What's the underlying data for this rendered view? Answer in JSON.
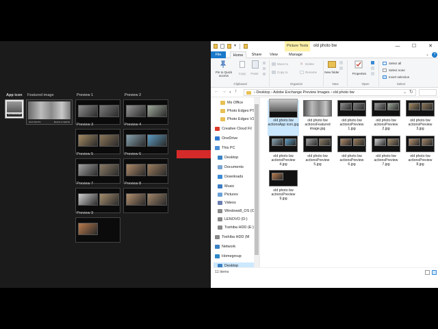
{
  "left_panel": {
    "app_icon_label": "App icon",
    "featured_label": "Featured image",
    "app_icon_caption": "OLD PHOTO BW",
    "featured_caption_left": "OLD PHOTO",
    "featured_caption_right": "BLACK & WHITE",
    "previews": [
      {
        "label": "Preview 1",
        "mini_a": "#8c8c8c",
        "mini_b": "#7a7a7a"
      },
      {
        "label": "Preview 2",
        "mini_a": "#969696",
        "mini_b": "#9ea89a"
      },
      {
        "label": "Preview 3",
        "mini_a": "#a48a62",
        "mini_b": "#8c7658"
      },
      {
        "label": "Preview 4",
        "mini_a": "#86a2b0",
        "mini_b": "#5b9ac0"
      },
      {
        "label": "Preview 5",
        "mini_a": "#a0a0a0",
        "mini_b": "#8a7a64"
      },
      {
        "label": "Preview 6",
        "mini_a": "#b08a68",
        "mini_b": "#9b7d5c"
      },
      {
        "label": "Preview 7",
        "mini_a": "#cfcfcf",
        "mini_b": "#a58d6c"
      },
      {
        "label": "Preview 8",
        "mini_a": "#b4906e",
        "mini_b": "#a08468"
      },
      {
        "label": "Preview 9",
        "mini_a": "#b87a4c",
        "mini_b": ""
      }
    ]
  },
  "arrow_color": "#d42a2a",
  "window": {
    "contextual_tab": "Picture Tools",
    "title": "old photo bw",
    "controls": {
      "minimize": "—",
      "maximize": "☐",
      "close": "✕"
    },
    "tabs": {
      "file": "File",
      "home": "Home",
      "share": "Share",
      "view": "View",
      "manage": "Manage"
    },
    "help_badge": "?",
    "ribbon": {
      "pin": "Pin to Quick access",
      "copy": "Copy",
      "paste": "Paste",
      "move_to": "Move to",
      "copy_to": "Copy to",
      "delete": "Delete",
      "rename": "Rename",
      "new_folder": "New folder",
      "properties": "Properties",
      "select_all": "Select all",
      "select_none": "Select none",
      "invert_selection": "Invert selection",
      "groups": {
        "clipboard": "Clipboard",
        "organize": "Organize",
        "new": "New",
        "open": "Open",
        "select": "Select"
      }
    },
    "address": {
      "back": "←",
      "forward": "→",
      "up": "↑",
      "path": "›  Desktop  ›  Adobe Exchange Preview Images  ›  old photo bw",
      "dropdown": "⌄",
      "refresh": "↻"
    },
    "nav_items": [
      {
        "label": "Ms Office",
        "icon": "folder-icon",
        "color": "#e8c053"
      },
      {
        "label": "Photo Edges PSI",
        "icon": "folder-icon",
        "color": "#e8c053"
      },
      {
        "label": "Photo Edges V2",
        "icon": "folder-icon",
        "color": "#e8c053"
      },
      {
        "label": "Creative Cloud Fil",
        "icon": "creative-cloud-icon",
        "color": "#da3b2b"
      },
      {
        "label": "OneDrive",
        "icon": "cloud-icon",
        "color": "#2e78d4"
      },
      {
        "label": "This PC",
        "icon": "computer-icon",
        "color": "#4b8fd6"
      },
      {
        "label": "Desktop",
        "icon": "desktop-icon",
        "color": "#3b82c4"
      },
      {
        "label": "Documents",
        "icon": "documents-icon",
        "color": "#7aa4d1"
      },
      {
        "label": "Downloads",
        "icon": "downloads-icon",
        "color": "#3b8ad6"
      },
      {
        "label": "Music",
        "icon": "music-icon",
        "color": "#3b7cc4"
      },
      {
        "label": "Pictures",
        "icon": "pictures-icon",
        "color": "#6aa0d8"
      },
      {
        "label": "Videos",
        "icon": "videos-icon",
        "color": "#6a7fb0"
      },
      {
        "label": "Windows8_OS (C",
        "icon": "drive-icon",
        "color": "#8a8a8a"
      },
      {
        "label": "LENOVO (D:)",
        "icon": "drive-icon",
        "color": "#8a8a8a"
      },
      {
        "label": "Toshiba HDD (E:)",
        "icon": "drive-icon",
        "color": "#8a8a8a"
      },
      {
        "label": "Toshiba HDD (M",
        "icon": "drive-icon",
        "color": "#8a8a8a"
      },
      {
        "label": "Network",
        "icon": "network-icon",
        "color": "#3b82c4"
      },
      {
        "label": "Homegroup",
        "icon": "homegroup-icon",
        "color": "#2f88c8"
      },
      {
        "label": "Desktop",
        "icon": "desktop-icon",
        "color": "#3b82c4"
      }
    ],
    "files": [
      {
        "name": "old photo bw actionsApp icon.jpg",
        "style": "app"
      },
      {
        "name": "old photo bw actionsFeatured image.jpg",
        "style": "featured"
      },
      {
        "name": "old photo bw actionsPreview 1.jpg",
        "mini_l": "#8c8c8c",
        "mini_r": "#7a7a7a"
      },
      {
        "name": "old photo bw actionsPreview 2.jpg",
        "mini_l": "#969696",
        "mini_r": "#9ea89a"
      },
      {
        "name": "old photo bw actionsPreview 3.jpg",
        "mini_l": "#a48a62",
        "mini_r": "#8c7658"
      },
      {
        "name": "old photo bw actionsPreview 4.jpg",
        "mini_l": "#86a2b0",
        "mini_r": "#5b9ac0"
      },
      {
        "name": "old photo bw actionsPreview 5.jpg",
        "mini_l": "#a0a0a0",
        "mini_r": "#8a7a64"
      },
      {
        "name": "old photo bw actionsPreview 6.jpg",
        "mini_l": "#b08a68",
        "mini_r": "#9b7d5c"
      },
      {
        "name": "old photo bw actionsPreview 7.jpg",
        "mini_l": "#cfcfcf",
        "mini_r": "#a58d6c"
      },
      {
        "name": "old photo bw actionsPreview 8.jpg",
        "mini_l": "#b4906e",
        "mini_r": "#a08468"
      },
      {
        "name": "old photo bw actionsPreview 9.jpg",
        "mini_l": "#b87a4c",
        "mini_r": ""
      }
    ],
    "status": {
      "count": "11 items"
    }
  }
}
